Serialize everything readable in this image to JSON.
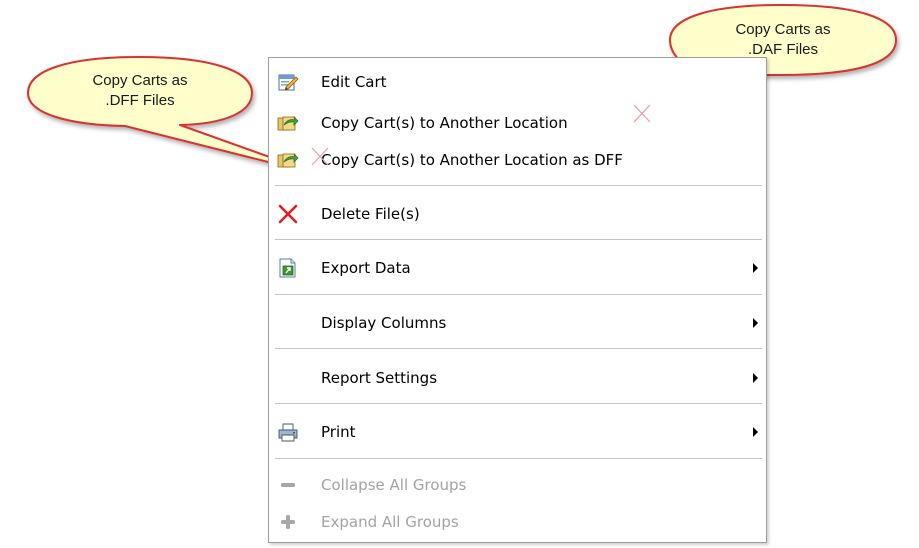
{
  "callouts": {
    "dff": {
      "text": "Copy Carts as\n.DFF Files"
    },
    "daf": {
      "text": "Copy Carts as\n.DAF Files"
    }
  },
  "menu": {
    "items": [
      {
        "label": "Edit Cart",
        "icon": "edit-cart-icon",
        "enabled": true,
        "submenu": false
      },
      {
        "label": "Copy Cart(s) to Another Location",
        "icon": "copy-carts-icon",
        "enabled": true,
        "submenu": false
      },
      {
        "label": "Copy Cart(s) to Another Location as DFF",
        "icon": "copy-carts-dff-icon",
        "enabled": true,
        "submenu": false
      },
      {
        "label": "Delete File(s)",
        "icon": "delete-icon",
        "enabled": true,
        "submenu": false
      },
      {
        "label": "Export Data",
        "icon": "export-data-icon",
        "enabled": true,
        "submenu": true
      },
      {
        "label": "Display Columns",
        "icon": "",
        "enabled": true,
        "submenu": true
      },
      {
        "label": "Report Settings",
        "icon": "",
        "enabled": true,
        "submenu": true
      },
      {
        "label": "Print",
        "icon": "printer-icon",
        "enabled": true,
        "submenu": true
      },
      {
        "label": "Collapse All Groups",
        "icon": "minus-icon",
        "enabled": false,
        "submenu": false
      },
      {
        "label": "Expand All Groups",
        "icon": "plus-icon",
        "enabled": false,
        "submenu": false
      }
    ]
  },
  "colors": {
    "callout_fill": "#ffffcc",
    "callout_border": "#d93030",
    "disabled_text": "#a3a3a3",
    "delete_red": "#e02020"
  }
}
